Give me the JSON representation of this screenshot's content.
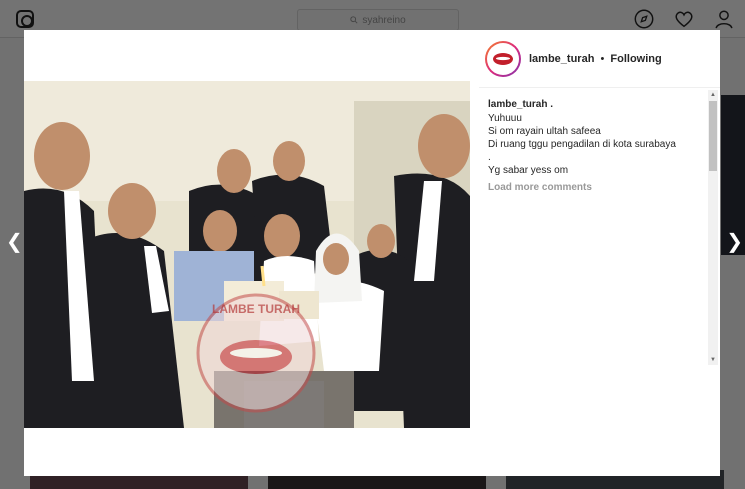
{
  "search": {
    "placeholder": "syahreino"
  },
  "post": {
    "username": "lambe_turah",
    "separator": "•",
    "follow_status": "Following",
    "caption_user": "lambe_turah .",
    "caption_lines": [
      "Yuhuuu",
      "Si om rayain ultah safeea",
      "Di ruang tggu pengadilan di kota surabaya",
      ".",
      "Yg sabar yess om"
    ],
    "load_more": "Load more comments"
  },
  "watermark": {
    "text": "LAMBE TURAH"
  },
  "colors": {
    "accent": "#dd2a7b",
    "text": "#262626",
    "muted": "#999999"
  }
}
